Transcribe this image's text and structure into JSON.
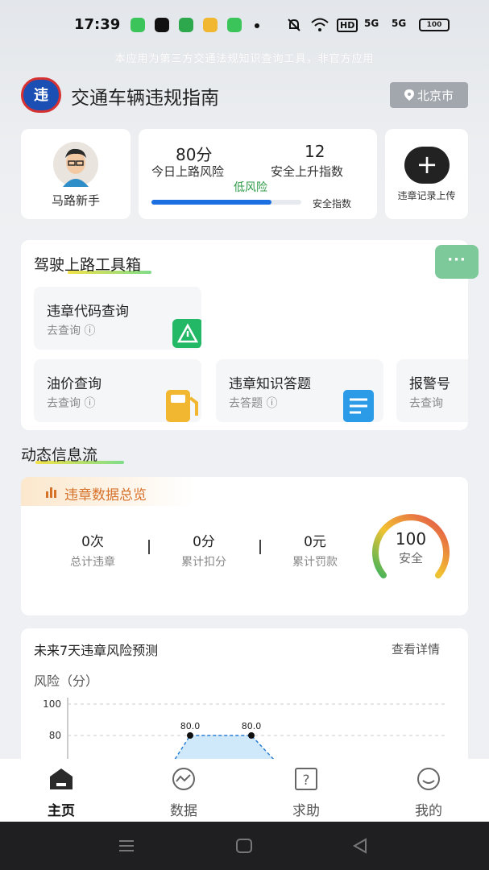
{
  "status_bar": {
    "time": "17:39",
    "signal_1": "5G",
    "signal_2": "5G",
    "network_tag": "HD",
    "battery": "100"
  },
  "disclaimer": "本应用为第三方交通法规知识查询工具，非官方应用",
  "header": {
    "logo_text": "违",
    "title": "交通车辆违规指南",
    "city": "北京市"
  },
  "user": {
    "name": "马路新手"
  },
  "risk": {
    "score": "80分",
    "score_label": "今日上路风险",
    "safety_rise": "12",
    "safety_rise_label": "安全上升指数",
    "level": "低风险",
    "safety_index_label": "安全指数",
    "progress": 0.8
  },
  "upload": {
    "icon": "plus-icon",
    "label": "违章记录上传"
  },
  "toolbox": {
    "title": "驾驶上路工具箱",
    "more": "···",
    "tools": [
      {
        "title": "违章代码查询",
        "sub": "去查询",
        "icon": "warning-sign-icon"
      },
      {
        "title": "油价查询",
        "sub": "去查询",
        "icon": "fuel-pump-icon"
      },
      {
        "title": "违章知识答题",
        "sub": "去答题",
        "icon": "document-icon"
      },
      {
        "title": "报警号",
        "sub": "去查询",
        "icon": "phone-icon"
      }
    ]
  },
  "info": {
    "title": "动态信息流",
    "overview_tab": "违章数据总览",
    "stats": [
      {
        "value": "0次",
        "label": "总计违章"
      },
      {
        "value": "0分",
        "label": "累计扣分"
      },
      {
        "value": "0元",
        "label": "累计罚款"
      }
    ],
    "separator": "|",
    "gauge": {
      "score": "100",
      "label": "安全",
      "value": 100
    }
  },
  "forecast": {
    "title": "未来7天违章风险预测",
    "link": "查看详情",
    "axis_label": "风险（分）"
  },
  "chart_data": {
    "type": "area",
    "title": "",
    "ylabel": "风险（分）",
    "y_ticks": [
      "100",
      "80"
    ],
    "ylim": [
      0,
      100
    ],
    "series": [
      {
        "values": [
          80.0,
          80.0
        ],
        "labels": [
          "80.0",
          "80.0"
        ]
      }
    ]
  },
  "tabs": [
    {
      "label": "主页",
      "icon": "home-icon",
      "active": true
    },
    {
      "label": "数据",
      "icon": "chart-wave-icon",
      "active": false
    },
    {
      "label": "求助",
      "icon": "question-icon",
      "active": false
    },
    {
      "label": "我的",
      "icon": "smile-icon",
      "active": false
    }
  ],
  "colors": {
    "accent_blue": "#1c6fe0",
    "risk_green": "#2f9a48",
    "warning_orange": "#d6712a",
    "more_button": "#7ec99a"
  }
}
